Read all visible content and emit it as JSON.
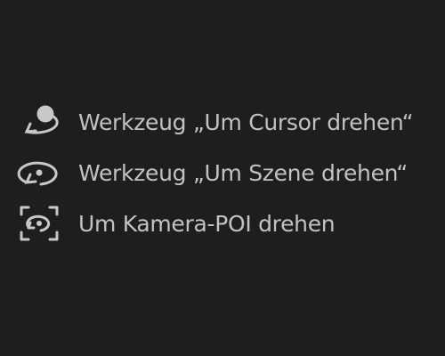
{
  "menu": {
    "items": [
      {
        "icon": "orbit-around-cursor-icon",
        "label": "Werkzeug „Um Cursor drehen“"
      },
      {
        "icon": "orbit-scene-icon",
        "label": "Werkzeug „Um Szene drehen“"
      },
      {
        "icon": "orbit-camera-poi-icon",
        "label": "Um Kamera-POI drehen"
      }
    ]
  },
  "colors": {
    "background": "#1e1e1e",
    "text": "#c2c2c2",
    "icon": "#c8c8c8"
  }
}
